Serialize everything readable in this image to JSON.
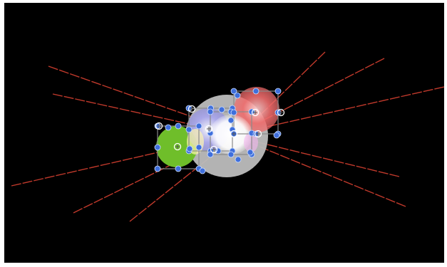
{
  "canvas": {
    "background": "#000000",
    "frame_color": "#ffffff"
  },
  "colors": {
    "ray": "#c0392b",
    "handle_blue": "#3f6fdc",
    "handle_outline": "#ffffff",
    "bbox_stroke": "#8a8a8a",
    "circle_gray": "#bdbdbd",
    "circle_green": "#6fbe2a",
    "circle_red": "#ef6b6b",
    "circle_lavender": "#a9a6f2",
    "circle_white": "#ffffff"
  },
  "scene": {
    "shapes": [
      {
        "id": "gray-circle",
        "color_key": "circle_gray"
      },
      {
        "id": "green-circle",
        "color_key": "circle_green"
      },
      {
        "id": "red-circle",
        "color_key": "circle_red"
      },
      {
        "id": "lavender-circle",
        "color_key": "circle_lavender"
      },
      {
        "id": "white-circle",
        "color_key": "circle_white"
      }
    ],
    "icons": [
      "transform-handle-icon",
      "anchor-point-icon",
      "light-ray-icon"
    ]
  }
}
